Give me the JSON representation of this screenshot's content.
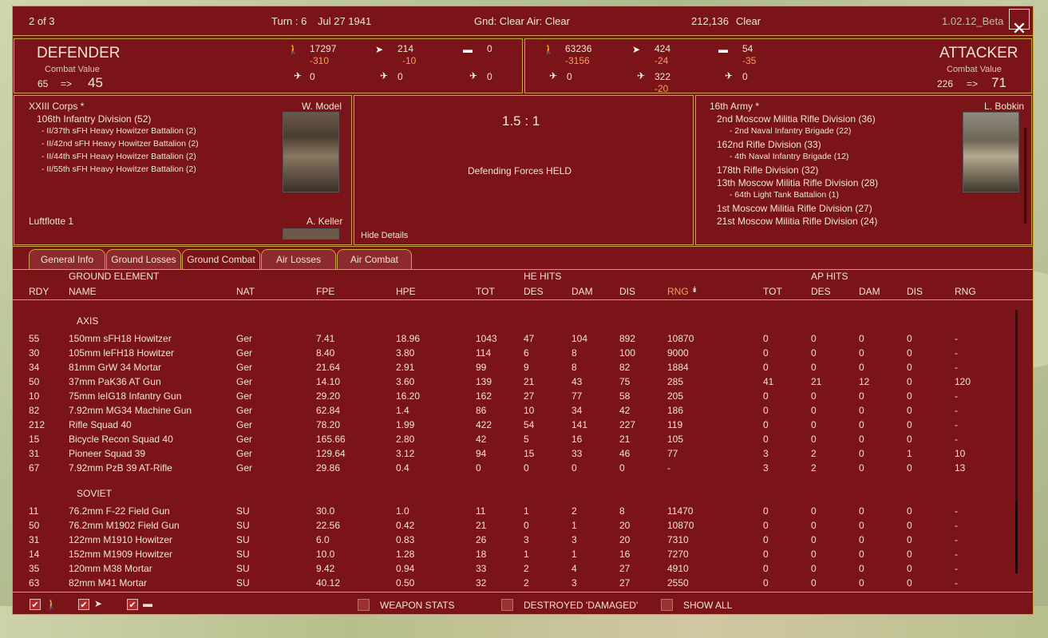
{
  "topbar": {
    "page": "2 of 3",
    "turn": "Turn : 6",
    "date": "Jul 27 1941",
    "weather": "Gnd: Clear  Air: Clear",
    "hex": "212,136",
    "hex_weather": "Clear",
    "version": "1.02.12_Beta",
    "close": "✕"
  },
  "defender": {
    "title": "DEFENDER",
    "cv_label": "Combat Value",
    "cv_from": "65",
    "arrow": "=>",
    "cv_to": "45",
    "men": "17297",
    "men_loss": "-310",
    "afv_a": "214",
    "afv_a_loss": "-10",
    "tanks": "0",
    "air1": "0",
    "air2": "0",
    "air3": "0"
  },
  "attacker": {
    "title": "ATTACKER",
    "cv_label": "Combat Value",
    "cv_from": "226",
    "arrow": "=>",
    "cv_to": "71",
    "men": "63236",
    "men_loss": "-3156",
    "afv_a": "424",
    "afv_a_loss": "-24",
    "tanks": "54",
    "tanks_loss": "-35",
    "air1": "0",
    "air2": "322",
    "air2_loss": "-20",
    "air3": "0"
  },
  "def_units": {
    "hq": "XXIII Corps *",
    "leader": "W. Model",
    "div": "106th Infantry Division (52)",
    "subs": [
      "- II/37th sFH Heavy Howitzer Battalion (2)",
      "- II/42nd sFH Heavy Howitzer Battalion (2)",
      "- II/44th sFH Heavy Howitzer Battalion (2)",
      "- II/55th sFH Heavy Howitzer Battalion (2)"
    ],
    "air": "Luftflotte 1",
    "air_leader": "A. Keller"
  },
  "center": {
    "odds": "1.5 : 1",
    "result": "Defending Forces HELD",
    "hide": "Hide Details"
  },
  "att_units": {
    "hq": "16th Army *",
    "leader": "L. Bobkin",
    "lines": [
      {
        "t": "2nd Moscow Militia Rifle Division (36)",
        "s": false
      },
      {
        "t": "- 2nd Naval Infantry Brigade (22)",
        "s": true
      },
      {
        "t": "162nd Rifle Division (33)",
        "s": false
      },
      {
        "t": "- 4th Naval Infantry Brigade (12)",
        "s": true
      },
      {
        "t": "178th Rifle Division (32)",
        "s": false
      },
      {
        "t": "13th Moscow Militia Rifle Division (28)",
        "s": false
      },
      {
        "t": "- 64th Light Tank Battalion (1)",
        "s": true
      },
      {
        "t": "1st Moscow Militia Rifle Division (27)",
        "s": false
      },
      {
        "t": "21st Moscow Militia Rifle Division (24)",
        "s": false
      }
    ]
  },
  "tabs": [
    "General Info",
    "Ground Losses",
    "Ground Combat",
    "Air Losses",
    "Air Combat"
  ],
  "headers": {
    "ground_element": "GROUND ELEMENT",
    "he_hits": "HE HITS",
    "ap_hits": "AP HITS",
    "rdy": "RDY",
    "name": "NAME",
    "nat": "NAT",
    "fpe": "FPE",
    "hpe": "HPE",
    "tot": "TOT",
    "des": "DES",
    "dam": "DAM",
    "dis": "DIS",
    "rng": "RNG",
    "sort_icon": "chevron-down-double"
  },
  "groups": {
    "axis": "AXIS",
    "soviet": "SOVIET"
  },
  "axis_rows": [
    [
      "55",
      "150mm sFH18 Howitzer",
      "Ger",
      "7.41",
      "18.96",
      "1043",
      "47",
      "104",
      "892",
      "10870",
      "0",
      "0",
      "0",
      "0",
      "-"
    ],
    [
      "30",
      "105mm leFH18 Howitzer",
      "Ger",
      "8.40",
      "3.80",
      "114",
      "6",
      "8",
      "100",
      "9000",
      "0",
      "0",
      "0",
      "0",
      "-"
    ],
    [
      "34",
      "81mm GrW 34 Mortar",
      "Ger",
      "21.64",
      "2.91",
      "99",
      "9",
      "8",
      "82",
      "1884",
      "0",
      "0",
      "0",
      "0",
      "-"
    ],
    [
      "50",
      "37mm PaK36 AT Gun",
      "Ger",
      "14.10",
      "3.60",
      "139",
      "21",
      "43",
      "75",
      "285",
      "41",
      "21",
      "12",
      "0",
      "120"
    ],
    [
      "10",
      "75mm leIG18 Infantry Gun",
      "Ger",
      "29.20",
      "16.20",
      "162",
      "27",
      "77",
      "58",
      "205",
      "0",
      "0",
      "0",
      "0",
      "-"
    ],
    [
      "82",
      "7.92mm MG34 Machine Gun",
      "Ger",
      "62.84",
      "1.4",
      "86",
      "10",
      "34",
      "42",
      "186",
      "0",
      "0",
      "0",
      "0",
      "-"
    ],
    [
      "212",
      "Rifle Squad 40",
      "Ger",
      "78.20",
      "1.99",
      "422",
      "54",
      "141",
      "227",
      "119",
      "0",
      "0",
      "0",
      "0",
      "-"
    ],
    [
      "15",
      "Bicycle Recon Squad 40",
      "Ger",
      "165.66",
      "2.80",
      "42",
      "5",
      "16",
      "21",
      "105",
      "0",
      "0",
      "0",
      "0",
      "-"
    ],
    [
      "31",
      "Pioneer Squad 39",
      "Ger",
      "129.64",
      "3.12",
      "94",
      "15",
      "33",
      "46",
      "77",
      "3",
      "2",
      "0",
      "1",
      "10"
    ],
    [
      "67",
      "7.92mm PzB 39 AT-Rifle",
      "Ger",
      "29.86",
      "0.4",
      "0",
      "0",
      "0",
      "0",
      "-",
      "3",
      "2",
      "0",
      "0",
      "13"
    ]
  ],
  "soviet_rows": [
    [
      "11",
      "76.2mm F-22 Field Gun",
      "SU",
      "30.0",
      "1.0",
      "11",
      "1",
      "2",
      "8",
      "11470",
      "0",
      "0",
      "0",
      "0",
      "-"
    ],
    [
      "50",
      "76.2mm M1902 Field Gun",
      "SU",
      "22.56",
      "0.42",
      "21",
      "0",
      "1",
      "20",
      "10870",
      "0",
      "0",
      "0",
      "0",
      "-"
    ],
    [
      "31",
      "122mm M1910 Howitzer",
      "SU",
      "6.0",
      "0.83",
      "26",
      "3",
      "3",
      "20",
      "7310",
      "0",
      "0",
      "0",
      "0",
      "-"
    ],
    [
      "14",
      "152mm M1909 Howitzer",
      "SU",
      "10.0",
      "1.28",
      "18",
      "1",
      "1",
      "16",
      "7270",
      "0",
      "0",
      "0",
      "0",
      "-"
    ],
    [
      "35",
      "120mm M38 Mortar",
      "SU",
      "9.42",
      "0.94",
      "33",
      "2",
      "4",
      "27",
      "4910",
      "0",
      "0",
      "0",
      "0",
      "-"
    ],
    [
      "63",
      "82mm M41 Mortar",
      "SU",
      "40.12",
      "0.50",
      "32",
      "2",
      "3",
      "27",
      "2550",
      "0",
      "0",
      "0",
      "0",
      "-"
    ]
  ],
  "footer": {
    "weapon_stats": "WEAPON STATS",
    "destroyed": "DESTROYED 'DAMAGED'",
    "show_all": "SHOW ALL",
    "check": "✔"
  }
}
